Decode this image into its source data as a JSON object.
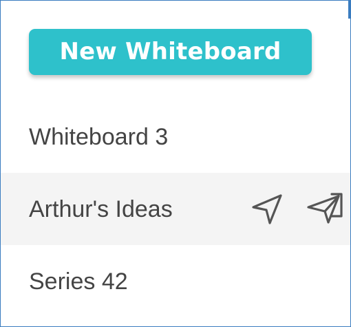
{
  "new_button": {
    "label": "New Whiteboard"
  },
  "whiteboards": [
    {
      "label": "Whiteboard 3"
    },
    {
      "label": "Arthur's Ideas"
    },
    {
      "label": "Series 42"
    }
  ],
  "icons": {
    "send": "send-icon",
    "share": "share-icon"
  },
  "colors": {
    "accent": "#2ec1cb",
    "text": "#444444",
    "icon": "#555555",
    "hover_bg": "#f4f4f4",
    "frame": "#3a7cc0"
  }
}
